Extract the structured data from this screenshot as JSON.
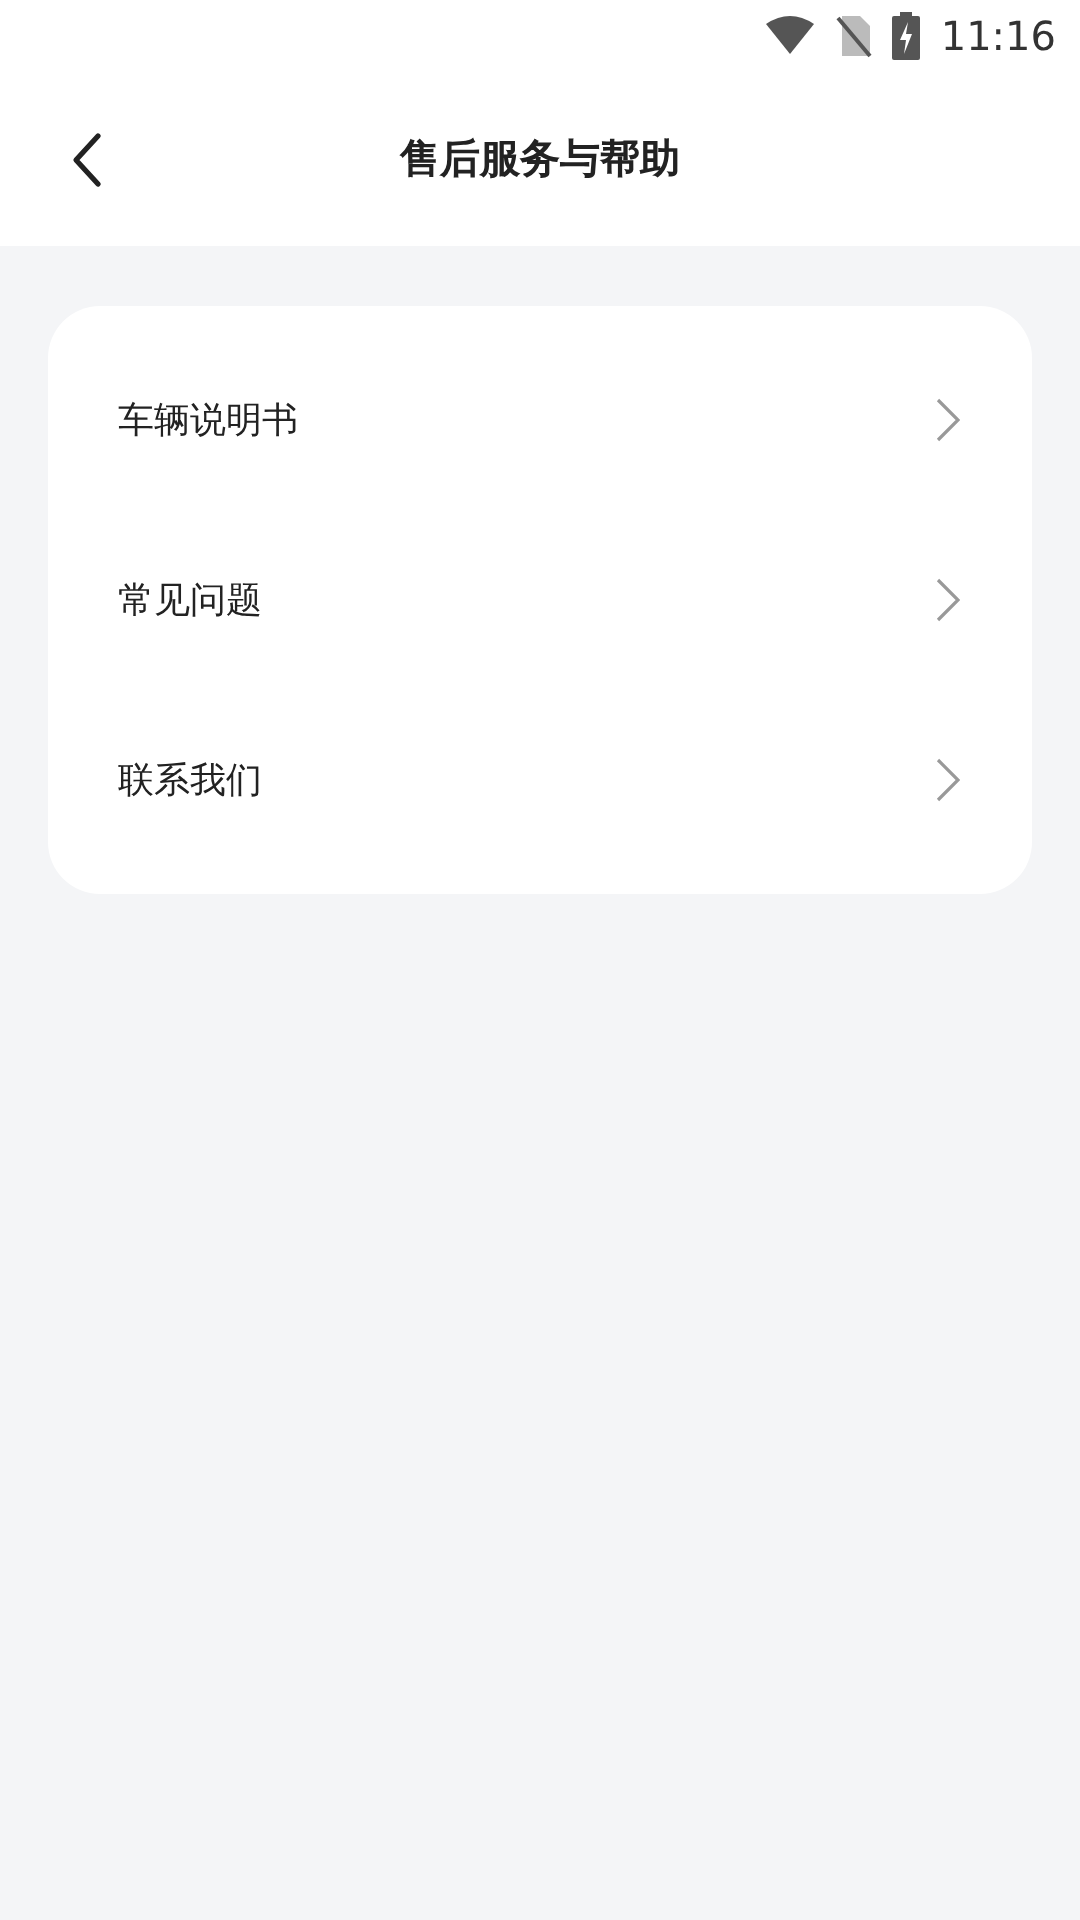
{
  "status_bar": {
    "time": "11:16"
  },
  "header": {
    "title": "售后服务与帮助"
  },
  "menu": {
    "items": [
      {
        "label": "车辆说明书"
      },
      {
        "label": "常见问题"
      },
      {
        "label": "联系我们"
      }
    ]
  }
}
